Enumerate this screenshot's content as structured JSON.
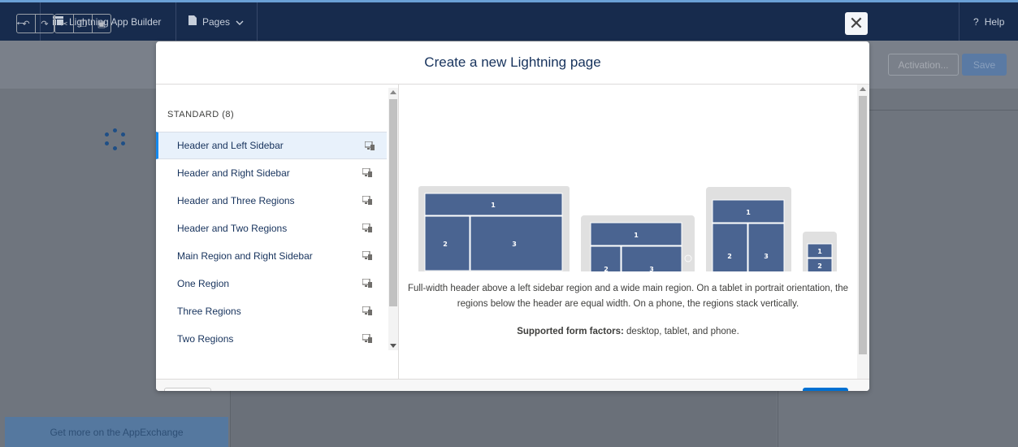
{
  "topbar": {
    "back_icon": "arrow-left-icon",
    "app_name": "Lightning App Builder",
    "app_icon": "app-builder-icon",
    "pages_label": "Pages",
    "pages_icon": "page-icon",
    "help_label": "Help",
    "help_icon": "question-icon"
  },
  "toolbar": {
    "tools": [
      "undo-icon",
      "redo-icon",
      "cut-icon",
      "copy-icon",
      "paste-icon"
    ],
    "activation_label": "Activation...",
    "save_label": "Save"
  },
  "left_panel": {
    "appexchange_label": "Get more on the AppExchange"
  },
  "modal": {
    "title": "Create a new Lightning page",
    "close_icon": "close-icon",
    "section_heading": "STANDARD (8)",
    "templates": [
      {
        "label": "Header and Left Sidebar",
        "selected": true
      },
      {
        "label": "Header and Right Sidebar",
        "selected": false
      },
      {
        "label": "Header and Three Regions",
        "selected": false
      },
      {
        "label": "Header and Two Regions",
        "selected": false
      },
      {
        "label": "Main Region and Right Sidebar",
        "selected": false
      },
      {
        "label": "One Region",
        "selected": false
      },
      {
        "label": "Three Regions",
        "selected": false
      },
      {
        "label": "Two Regions",
        "selected": false
      }
    ],
    "preview": {
      "region_labels": [
        "1",
        "2",
        "3"
      ],
      "description": "Full-width header above a left sidebar region and a wide main region. On a tablet in portrait orientation, the regions below the header are equal width. On a phone, the regions stack vertically.",
      "factors_label": "Supported form factors:",
      "factors_value": "desktop, tablet, and phone."
    },
    "colors": {
      "region": "#4a6491",
      "device": "#e0e0e0",
      "accent": "#1589ee"
    }
  }
}
